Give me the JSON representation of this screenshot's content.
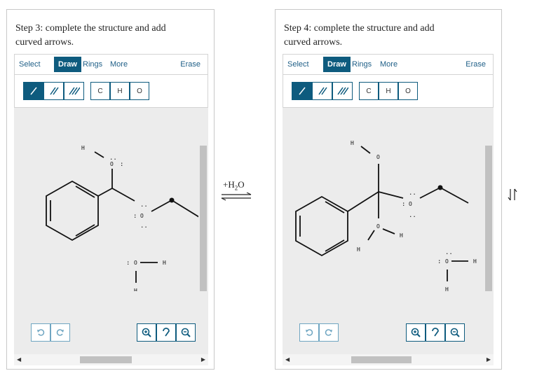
{
  "left_panel": {
    "prompt": "Step 3: complete the structure and add curved arrows.",
    "toolbar": {
      "select": "Select",
      "draw": "Draw",
      "rings": "Rings",
      "more": "More",
      "erase": "Erase"
    },
    "atoms": [
      "C",
      "H",
      "O"
    ],
    "structure": {
      "labels": {
        "h_top": "H",
        "o_top": "O",
        "o_right": "O",
        "o_water": "O",
        "h_water_right": "H",
        "h_water_bottom": "H"
      },
      "lone_pairs": ":",
      "dots": ".."
    }
  },
  "right_panel": {
    "prompt": "Step 4: complete the structure and add curved arrows.",
    "toolbar": {
      "select": "Select",
      "draw": "Draw",
      "rings": "Rings",
      "more": "More",
      "erase": "Erase"
    },
    "atoms": [
      "C",
      "H",
      "O"
    ],
    "structure": {
      "labels": {
        "h_top": "H",
        "o_top": "O",
        "o_right": "O",
        "o_low": "O",
        "h_low_right": "H",
        "h_low_left": "H",
        "o_water": "O",
        "h_water_right": "H",
        "h_water_bottom": "H"
      },
      "lone_pairs": ":",
      "dots": ".."
    }
  },
  "reagent": {
    "text": "+H",
    "subscript": "2",
    "tail": "O"
  },
  "colors": {
    "accent": "#0e5b7e",
    "canvas": "#ececec",
    "border": "#c8c8c8"
  }
}
